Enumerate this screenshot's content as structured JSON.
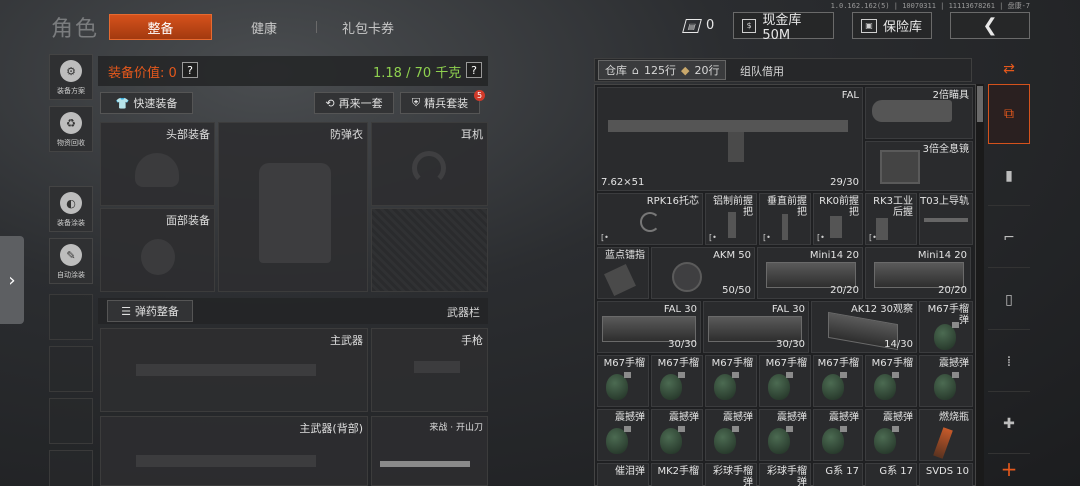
{
  "version": "1.0.162.162(5) | 10070311 | 11113678261 | 盘康-7",
  "title": "角色",
  "tabs": [
    {
      "label": "整备",
      "active": true
    },
    {
      "label": "健康",
      "active": false
    },
    {
      "label": "礼包卡券",
      "active": false
    }
  ],
  "topbar": {
    "ticket_count": "0",
    "cash_label": "现金库 50M",
    "safe_label": "保险库",
    "back_icon": "chevron-left-icon"
  },
  "sidebar": {
    "items": [
      {
        "label": "装备方案",
        "icon": "loadout-icon"
      },
      {
        "label": "物资回收",
        "icon": "recycle-icon"
      },
      {
        "label": "装备涂装",
        "icon": "paint-icon"
      },
      {
        "label": "自动涂装",
        "icon": "auto-paint-icon"
      }
    ]
  },
  "equip": {
    "value_label": "装备价值: 0",
    "weight": "1.18 / 70 千克",
    "quick_equip": "快速装备",
    "again": "再来一套",
    "elite": "精兵套装",
    "elite_badge": "5",
    "slots": {
      "head": "头部装备",
      "armor": "防弹衣",
      "ear": "耳机",
      "face": "面部装备"
    },
    "ammo_equip": "弹药整备",
    "weapon_bar": "武器栏",
    "primary": "主武器",
    "pistol": "手枪",
    "primary_back": "主武器(背部)",
    "melee": "来战 · 开山刀"
  },
  "warehouse": {
    "tab": "仓库",
    "rows": "125行",
    "tickets": "20行",
    "team_borrow": "组队借用",
    "items": {
      "fal": "FAL",
      "fal_ammo": "7.62×51",
      "fal_count": "29/30",
      "scope": "2倍瞄具",
      "holo": "3倍全息镜",
      "rpk_stock": "RPK16托芯",
      "aluminum_grip": "铝制前握把",
      "vertical_grip": "垂直前握把",
      "rk0_grip": "RK0前握把",
      "rk3_grip": "RK3工业后握",
      "t03_rail": "T03上导轨",
      "blue_pad": "蓝点镭指",
      "akm50": "AKM 50",
      "akm50_count": "50/50",
      "mini14_a": "Mini14 20",
      "mini14_a_count": "20/20",
      "mini14_b": "Mini14 20",
      "mini14_b_count": "20/20",
      "fal30_a": "FAL 30",
      "fal30_a_count": "30/30",
      "fal30_b": "FAL 30",
      "fal30_b_count": "30/30",
      "ak12": "AK12 30观察",
      "ak12_count": "14/30",
      "m67": "M67手榴弹",
      "m67_short": "M67手榴",
      "flash": "震撼弹",
      "incendiary": "燃烧瓶",
      "row_bottom": [
        "催泪弹",
        "MK2手榴",
        "彩球手榴弹",
        "彩球手榴弹",
        "G系 17",
        "G系 17",
        "SVDS 10"
      ]
    }
  }
}
